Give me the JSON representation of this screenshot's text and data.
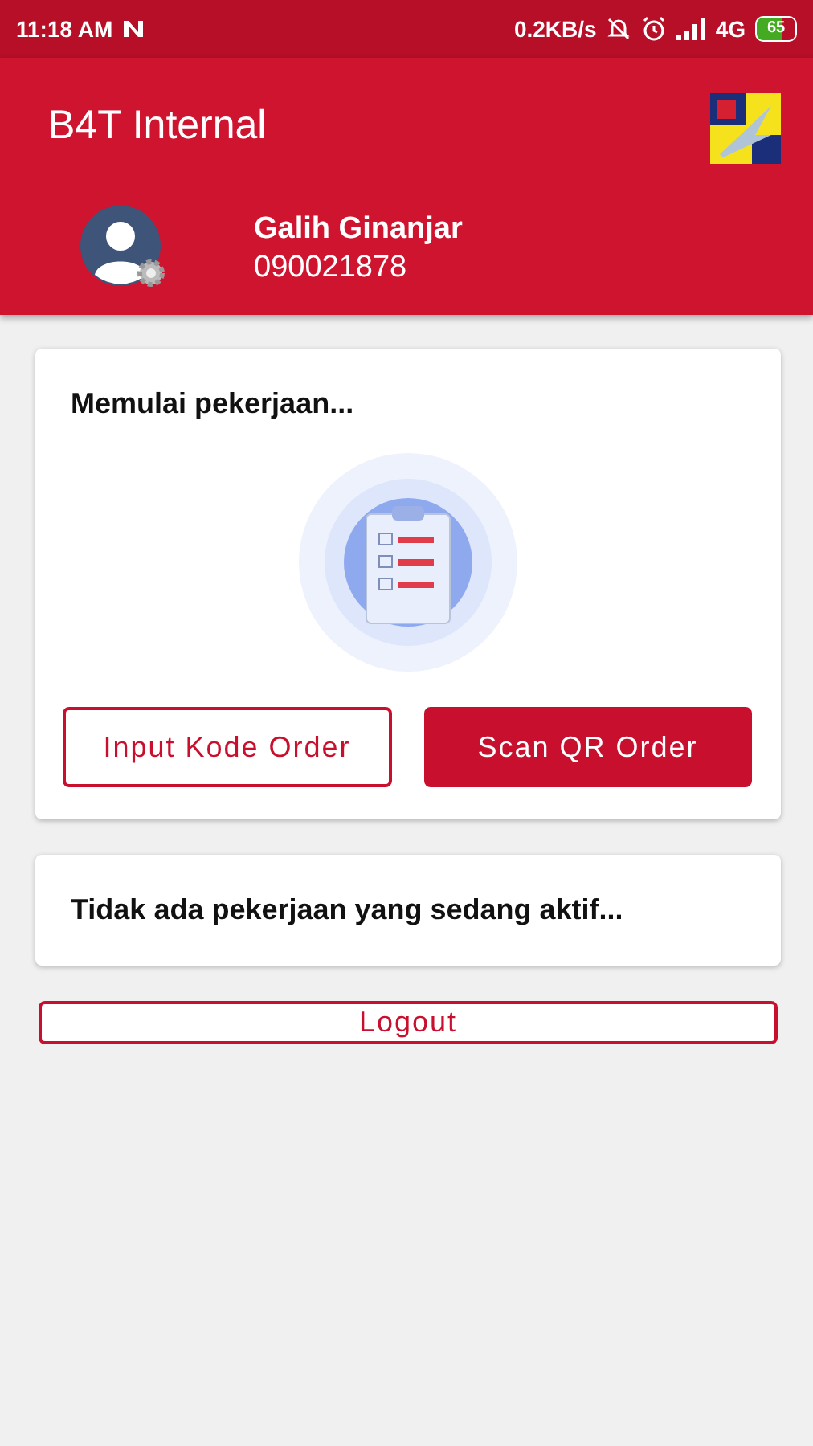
{
  "status_bar": {
    "time": "11:18 AM",
    "speed": "0.2KB/s",
    "network": "4G",
    "battery": "65"
  },
  "app_bar": {
    "title": "B4T Internal"
  },
  "profile": {
    "name": "Galih Ginanjar",
    "id": "090021878"
  },
  "start_card": {
    "title": "Memulai pekerjaan...",
    "buttons": [
      {
        "label": "Input Kode Order",
        "kind": "outlined"
      },
      {
        "label": "Scan QR Order",
        "kind": "filled"
      }
    ]
  },
  "active_card": {
    "message": "Tidak ada pekerjaan yang sedang aktif..."
  },
  "logout": {
    "label": "Logout"
  }
}
